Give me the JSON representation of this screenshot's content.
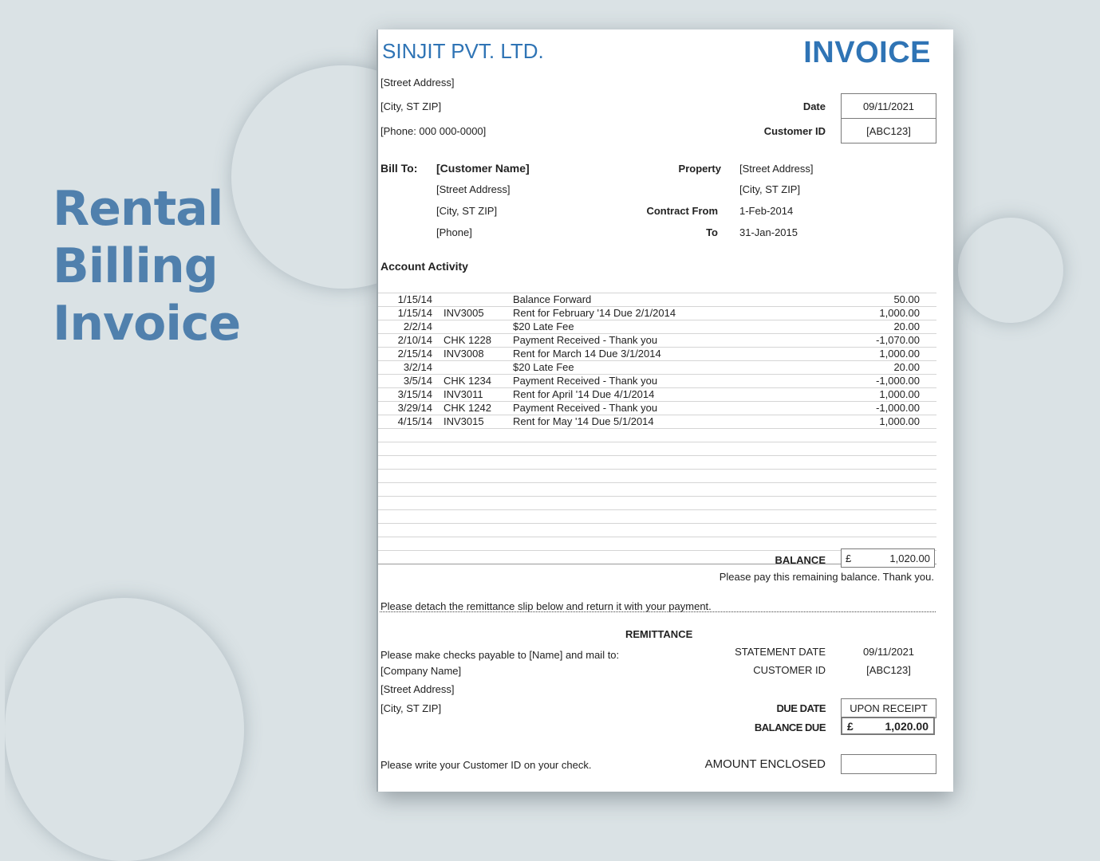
{
  "hero": {
    "lines": [
      "Rental",
      "Billing",
      "Invoice"
    ],
    "color": "#5080ad"
  },
  "invoice": {
    "company_name": "SINJIT PVT. LTD.",
    "title": "INVOICE",
    "company_address": {
      "street": "[Street Address]",
      "city": "[City, ST  ZIP]",
      "phone": "[Phone: 000 000-0000]"
    },
    "date_label": "Date",
    "date_value": "09/11/2021",
    "customer_id_label": "Customer ID",
    "customer_id_value": "[ABC123]",
    "bill_to": {
      "label": "Bill To:",
      "name": "[Customer Name]",
      "street": "[Street Address]",
      "city": "[City, ST  ZIP]",
      "phone": "[Phone]"
    },
    "property": {
      "label": "Property",
      "street": "[Street Address]",
      "city": "[City, ST  ZIP]",
      "contract_from_label": "Contract From",
      "contract_from_value": "1-Feb-2014",
      "to_label": "To",
      "to_value": "31-Jan-2015"
    },
    "account_activity_label": "Account Activity",
    "activity": [
      {
        "date": "1/15/14",
        "ref": "",
        "description": "Balance Forward",
        "amount": "50.00"
      },
      {
        "date": "1/15/14",
        "ref": "INV3005",
        "description": "Rent for February '14 Due 2/1/2014",
        "amount": "1,000.00"
      },
      {
        "date": "2/2/14",
        "ref": "",
        "description": "$20 Late Fee",
        "amount": "20.00"
      },
      {
        "date": "2/10/14",
        "ref": "CHK 1228",
        "description": "Payment Received - Thank you",
        "amount": "-1,070.00"
      },
      {
        "date": "2/15/14",
        "ref": "INV3008",
        "description": "Rent for March 14 Due 3/1/2014",
        "amount": "1,000.00"
      },
      {
        "date": "3/2/14",
        "ref": "",
        "description": "$20 Late Fee",
        "amount": "20.00"
      },
      {
        "date": "3/5/14",
        "ref": "CHK 1234",
        "description": "Payment Received - Thank you",
        "amount": "-1,000.00"
      },
      {
        "date": "3/15/14",
        "ref": "INV3011",
        "description": "Rent for April '14 Due 4/1/2014",
        "amount": "1,000.00"
      },
      {
        "date": "3/29/14",
        "ref": "CHK 1242",
        "description": "Payment Received - Thank you",
        "amount": "-1,000.00"
      },
      {
        "date": "4/15/14",
        "ref": "INV3015",
        "description": "Rent for May '14 Due 5/1/2014",
        "amount": "1,000.00"
      }
    ],
    "balance_label": "BALANCE",
    "currency_symbol": "£",
    "balance_value": "1,020.00",
    "balance_note": "Please pay this remaining balance. Thank you.",
    "detach_note": "Please detach the remittance slip below and return it with your payment.",
    "remittance": {
      "title": "REMITTANCE",
      "payable_note": "Please make checks payable to [Name] and mail to:",
      "company": "[Company Name]",
      "street": "[Street Address]",
      "city": "[City, ST  ZIP]",
      "statement_date_label": "STATEMENT DATE",
      "statement_date_value": "09/11/2021",
      "customer_id_label": "CUSTOMER ID",
      "customer_id_value": "[ABC123]",
      "due_date_label": "DUE DATE",
      "due_date_value": "UPON RECEIPT",
      "balance_due_label": "BALANCE DUE",
      "balance_due_value": "1,020.00",
      "customer_id_note": "Please write your Customer ID on your check.",
      "amount_enclosed_label": "AMOUNT ENCLOSED",
      "amount_enclosed_value": ""
    },
    "accent_color": "#2f74b5"
  }
}
